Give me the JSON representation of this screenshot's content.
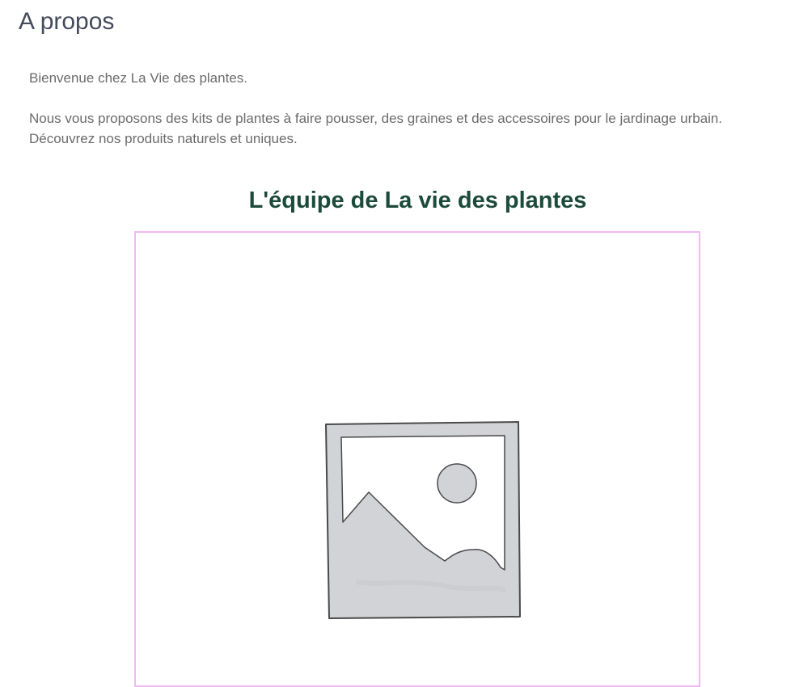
{
  "page": {
    "title": "A propos"
  },
  "intro": {
    "welcome": "Bienvenue chez La Vie des plantes.",
    "line1": "Nous vous proposons des kits de plantes à faire pousser, des graines et des accessoires pour le jardinage urbain.",
    "line2": "Découvrez nos produits naturels et uniques."
  },
  "team": {
    "title": "L'équipe de La vie des plantes",
    "image_icon": "image-placeholder-icon",
    "frame_border_color": "#f2b8f5"
  },
  "colors": {
    "title": "#444b5b",
    "body_text": "#6b6b6b",
    "heading_green": "#1c4a3b"
  }
}
